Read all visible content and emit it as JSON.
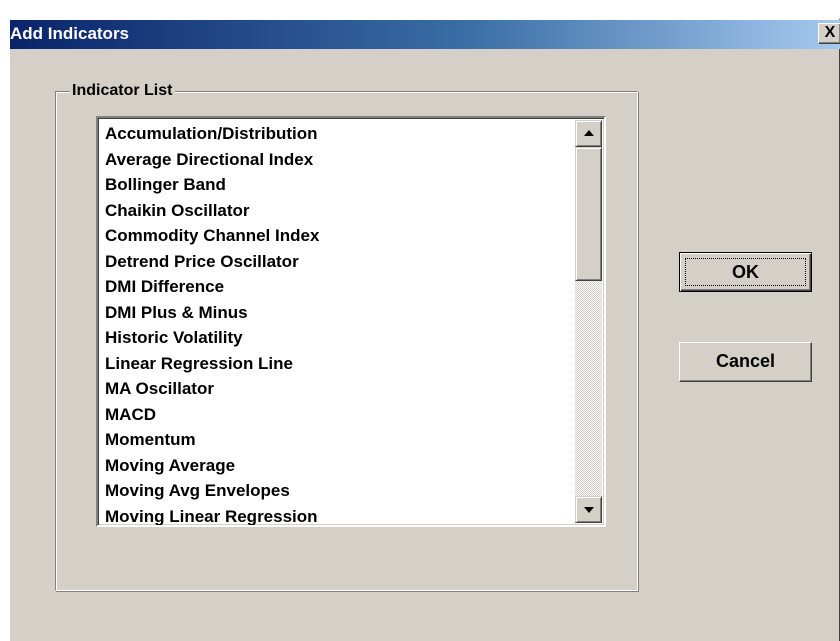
{
  "window": {
    "title": "Add Indicators",
    "close_label": "X"
  },
  "indicator_list": {
    "label": "Indicator List",
    "items": [
      "Accumulation/Distribution",
      "Average Directional Index",
      "Bollinger Band",
      "Chaikin Oscillator",
      "Commodity Channel Index",
      "Detrend Price Oscillator",
      "DMI Difference",
      "DMI Plus & Minus",
      "Historic Volatility",
      "Linear Regression Line",
      "MA Oscillator",
      "MACD",
      "Momentum",
      "Moving Average",
      "Moving Avg Envelopes",
      "Moving Linear Regression"
    ]
  },
  "buttons": {
    "ok": "OK",
    "cancel": "Cancel"
  },
  "colors": {
    "titlebar_start": "#0a246a",
    "titlebar_end": "#a6caf0",
    "face": "#d4d0c8"
  },
  "icons": {
    "scroll_up": "arrow-up-icon",
    "scroll_down": "arrow-down-icon",
    "close": "close-icon"
  }
}
